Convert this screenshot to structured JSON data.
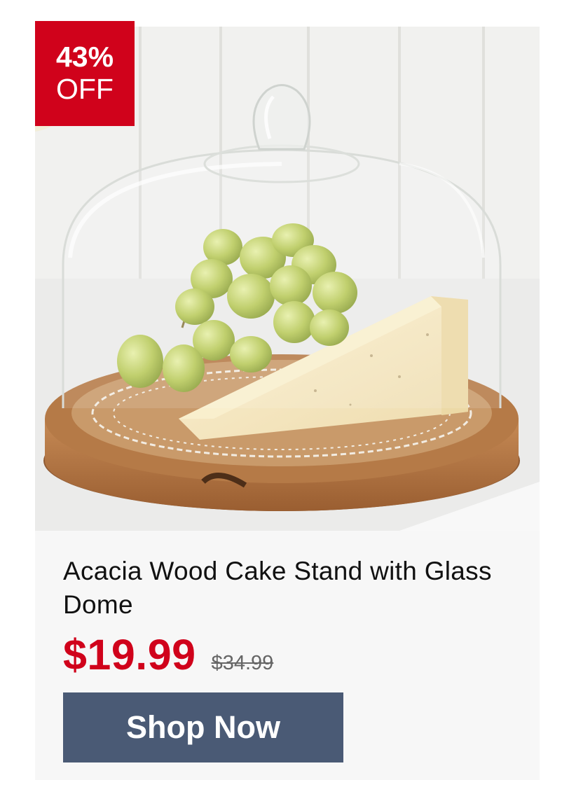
{
  "product": {
    "image_alt": "Acacia wood cake stand with glass dome holding grapes and cheese",
    "discount": {
      "percent": "43%",
      "off": "OFF"
    },
    "title": "Acacia Wood Cake Stand with Glass Dome",
    "sale_price": "$19.99",
    "original_price": "$34.99",
    "cta_label": "Shop Now"
  },
  "colors": {
    "sale_red": "#d0021b",
    "button_blue": "#4a5a75",
    "card_background": "#f7f7f7"
  }
}
